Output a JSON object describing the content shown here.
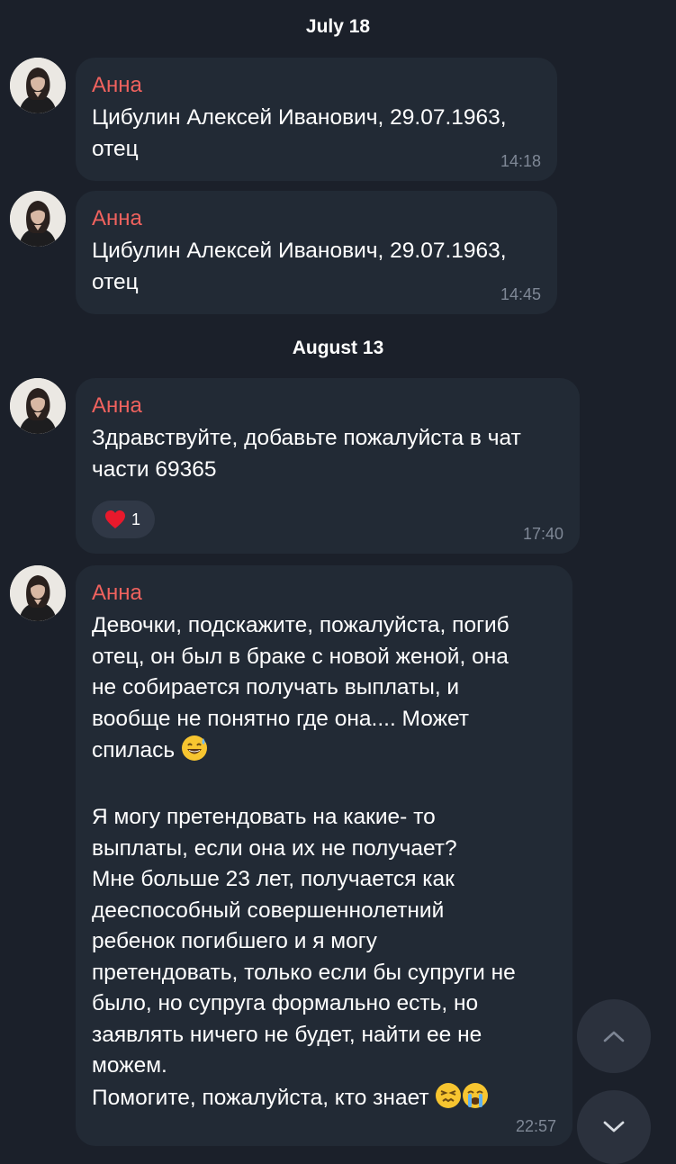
{
  "chat": {
    "dates": [
      "July 18",
      "August 13"
    ],
    "messages": [
      {
        "sender": "Анна",
        "text": "Цибулин Алексей Иванович, 29.07.1963,\nотец",
        "time": "14:18"
      },
      {
        "sender": "Анна",
        "text": "Цибулин Алексей Иванович, 29.07.1963,\nотец",
        "time": "14:45"
      },
      {
        "sender": "Анна",
        "text": "Здравствуйте, добавьте пожалуйста в чат\nчасти 69365",
        "reaction": {
          "icon": "heart-icon",
          "count": "1"
        },
        "time": "17:40"
      },
      {
        "sender": "Анна",
        "text_part1": "Девочки, подскажите, пожалуйста, погиб\nотец, он был в браке с новой женой, она\nне собирается получать выплаты, и\nвообще не понятно где она.... Может\nспилась",
        "text_part2": "Я могу претендовать на какие- то\nвыплаты, если она их не получает?\nМне больше 23 лет, получается как\nдееспособный совершеннолетний\nребенок погибшего и я могу\nпретендовать, только если бы супруги не\nбыло, но супруга формально есть, но\nзаявлять ничего не будет, найти ее не\nможем.\nПомогите, пожалуйста, кто знает",
        "time": "22:57"
      }
    ]
  },
  "icons": {
    "scroll_up": "chevron-up-icon",
    "scroll_down": "chevron-down-icon"
  },
  "colors": {
    "background": "#1b202a",
    "bubble": "#222a35",
    "sender_name": "#f0625e",
    "timestamp": "#7f8896"
  }
}
